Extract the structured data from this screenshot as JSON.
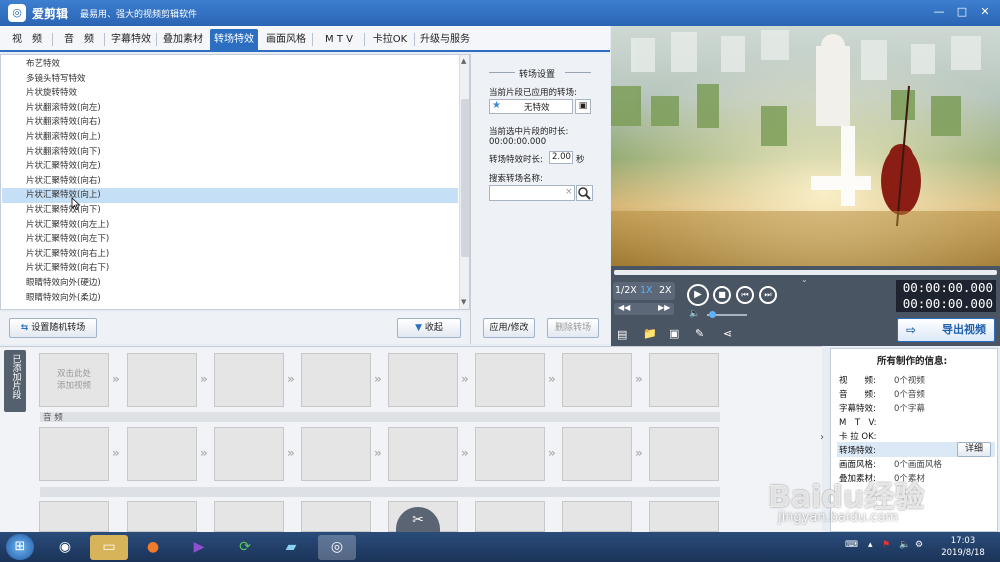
{
  "app": {
    "title": "爱剪辑",
    "slogan": "最易用、强大的视频剪辑软件"
  },
  "window_controls": [
    "—",
    "□",
    "✕"
  ],
  "tabs": [
    {
      "label": "视　频"
    },
    {
      "label": "音　频"
    },
    {
      "label": "字幕特效"
    },
    {
      "label": "叠加素材"
    },
    {
      "label": "转场特效"
    },
    {
      "label": "画面风格"
    },
    {
      "label": "M T V"
    },
    {
      "label": "卡拉OK"
    },
    {
      "label": "升级与服务"
    }
  ],
  "active_tab": "转场特效",
  "effects": [
    "布艺特效",
    "多镜头特写特效",
    "片状旋转特效",
    "片状翻滚特效(向左)",
    "片状翻滚特效(向右)",
    "片状翻滚特效(向上)",
    "片状翻滚特效(向下)",
    "片状汇聚特效(向左)",
    "片状汇聚特效(向右)",
    "片状汇聚特效(向上)",
    "片状汇聚特效(向下)",
    "片状汇聚特效(向左上)",
    "片状汇聚特效(向左下)",
    "片状汇聚特效(向右上)",
    "片状汇聚特效(向右下)",
    "眼睛特效向外(硬边)",
    "眼睛特效向外(柔边)"
  ],
  "selected_effect": "片状汇聚特效(向上)",
  "list_footer": {
    "random_button": "设置随机转场",
    "collapse_button": "收起"
  },
  "settings": {
    "title": "转场设置",
    "applied_label": "当前片段已应用的转场:",
    "applied_value": "无特效",
    "duration_label": "当前选中片段的时长:",
    "duration_value": "00:00:00.000",
    "effect_duration_label": "转场特效时长:",
    "effect_duration_value": "2.00",
    "effect_duration_unit": "秒",
    "search_label": "搜索转场名称:",
    "search_value": "",
    "apply_button": "应用/修改",
    "delete_button": "删除转场"
  },
  "player": {
    "speeds": [
      "1/2X",
      "1X",
      "2X"
    ],
    "active_speed": "1X",
    "time_current": "00:00:00.000",
    "time_total": "00:00:00.000",
    "progress": 0,
    "volume": 0
  },
  "export_button": "导出视频",
  "timeline": {
    "side_tab": "已添加片段",
    "add_clip_hint": "双击此处\n添加视频",
    "audio_label": "音 频"
  },
  "info": {
    "title": "所有制作的信息:",
    "rows": [
      {
        "label": "视　　频:",
        "value": "0个视频"
      },
      {
        "label": "音　　频:",
        "value": "0个音频"
      },
      {
        "label": "字幕特效:",
        "value": "0个字幕"
      },
      {
        "label": "M　T　V:",
        "value": ""
      },
      {
        "label": "卡 拉 OK:",
        "value": ""
      },
      {
        "label": "转场特效:",
        "value": ""
      },
      {
        "label": "画面风格:",
        "value": "0个画面风格"
      },
      {
        "label": "叠加素材:",
        "value": "0个素材"
      }
    ],
    "detail_button": "详细"
  },
  "watermark": "Baidu经验",
  "watermark_url": "jingyan.baidu.com",
  "taskbar": {
    "time": "17:03",
    "date": "2019/8/18"
  }
}
